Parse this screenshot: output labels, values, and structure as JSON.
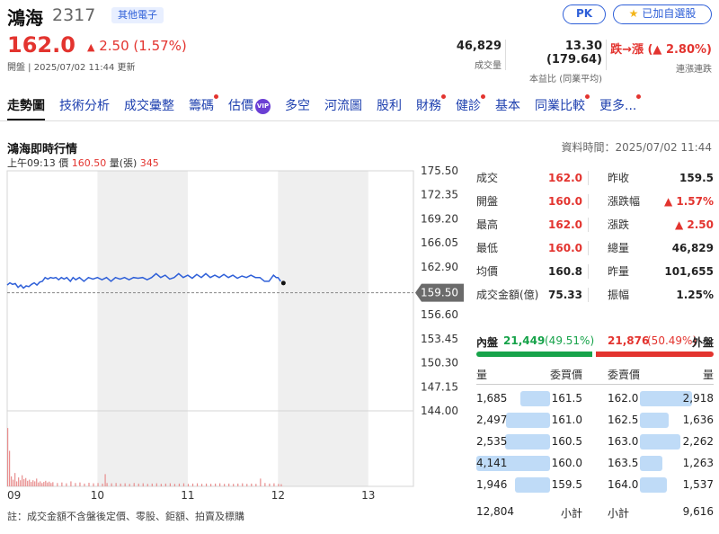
{
  "header": {
    "name": "鴻海",
    "code": "2317",
    "industry": "其他電子",
    "pk_label": "PK",
    "watchlist_label": "已加自選股",
    "price": "162.0",
    "change": "2.50 (1.57%)",
    "status": "開盤 | 2025/07/02 11:44 更新",
    "stats": [
      {
        "value": "46,829",
        "label": "成交量"
      },
      {
        "value": "13.30 (179.64)",
        "label": "本益比 (同業平均)"
      },
      {
        "value": "跌→漲 (▲ 2.80%)",
        "label": "連漲連跌"
      }
    ]
  },
  "tabs": [
    {
      "label": "走勢圖",
      "dot": false,
      "vip": false
    },
    {
      "label": "技術分析",
      "dot": false,
      "vip": false
    },
    {
      "label": "成交彙整",
      "dot": false,
      "vip": false
    },
    {
      "label": "籌碼",
      "dot": true,
      "vip": false
    },
    {
      "label": "估價",
      "dot": false,
      "vip": true
    },
    {
      "label": "多空",
      "dot": false,
      "vip": false
    },
    {
      "label": "河流圖",
      "dot": false,
      "vip": false
    },
    {
      "label": "股利",
      "dot": false,
      "vip": false
    },
    {
      "label": "財務",
      "dot": true,
      "vip": false
    },
    {
      "label": "健診",
      "dot": true,
      "vip": false
    },
    {
      "label": "基本",
      "dot": false,
      "vip": false
    },
    {
      "label": "同業比較",
      "dot": true,
      "vip": false
    },
    {
      "label": "更多...",
      "dot": true,
      "vip": false
    }
  ],
  "vip_label": "VIP",
  "section": {
    "title": "鴻海即時行情",
    "data_time": "資料時間：2025/07/02 11:44",
    "tick_time": "上午09:13",
    "tick_price_label": "價",
    "tick_price": "160.50",
    "tick_vol_label": "量(張)",
    "tick_vol": "345"
  },
  "chart_data": {
    "type": "line",
    "x_tick_labels": [
      "09",
      "10",
      "11",
      "12",
      "13"
    ],
    "y_tick_labels": [
      "175.50",
      "172.35",
      "169.20",
      "166.05",
      "162.90",
      "159.50",
      "156.60",
      "153.45",
      "150.30",
      "147.15",
      "144.00"
    ],
    "ylim": [
      144.0,
      175.5
    ],
    "reference_price": 159.5,
    "x_unit": "hours since 09:00",
    "price_series": [
      [
        0.0,
        160.5
      ],
      [
        0.03,
        160.8
      ],
      [
        0.06,
        160.6
      ],
      [
        0.09,
        160.7
      ],
      [
        0.12,
        160.2
      ],
      [
        0.15,
        160.5
      ],
      [
        0.18,
        160.1
      ],
      [
        0.21,
        160.4
      ],
      [
        0.24,
        160.3
      ],
      [
        0.27,
        160.6
      ],
      [
        0.3,
        160.8
      ],
      [
        0.33,
        160.5
      ],
      [
        0.36,
        160.9
      ],
      [
        0.39,
        161.0
      ],
      [
        0.42,
        161.5
      ],
      [
        0.45,
        161.3
      ],
      [
        0.48,
        161.5
      ],
      [
        0.51,
        161.4
      ],
      [
        0.54,
        161.5
      ],
      [
        0.57,
        161.2
      ],
      [
        0.6,
        161.5
      ],
      [
        0.63,
        161.3
      ],
      [
        0.66,
        161.5
      ],
      [
        0.7,
        161.0
      ],
      [
        0.73,
        161.5
      ],
      [
        0.76,
        161.2
      ],
      [
        0.8,
        161.5
      ],
      [
        0.85,
        161.0
      ],
      [
        0.9,
        161.5
      ],
      [
        0.95,
        161.3
      ],
      [
        1.0,
        161.5
      ],
      [
        1.05,
        161.2
      ],
      [
        1.1,
        161.5
      ],
      [
        1.15,
        161.0
      ],
      [
        1.2,
        161.5
      ],
      [
        1.25,
        161.3
      ],
      [
        1.3,
        161.5
      ],
      [
        1.35,
        161.2
      ],
      [
        1.4,
        161.5
      ],
      [
        1.45,
        161.4
      ],
      [
        1.5,
        161.5
      ],
      [
        1.55,
        161.2
      ],
      [
        1.6,
        161.5
      ],
      [
        1.65,
        162.0
      ],
      [
        1.7,
        161.5
      ],
      [
        1.75,
        161.8
      ],
      [
        1.8,
        161.3
      ],
      [
        1.85,
        161.5
      ],
      [
        1.9,
        162.0
      ],
      [
        1.95,
        161.5
      ],
      [
        2.0,
        161.8
      ],
      [
        2.05,
        161.4
      ],
      [
        2.1,
        161.9
      ],
      [
        2.15,
        161.5
      ],
      [
        2.2,
        162.0
      ],
      [
        2.25,
        161.5
      ],
      [
        2.3,
        161.8
      ],
      [
        2.35,
        161.5
      ],
      [
        2.4,
        161.9
      ],
      [
        2.45,
        161.5
      ],
      [
        2.5,
        161.8
      ],
      [
        2.55,
        161.4
      ],
      [
        2.6,
        161.7
      ],
      [
        2.65,
        161.5
      ],
      [
        2.7,
        161.8
      ],
      [
        2.75,
        161.5
      ],
      [
        2.8,
        161.5
      ],
      [
        2.85,
        161.0
      ],
      [
        2.9,
        161.0
      ],
      [
        2.95,
        161.8
      ],
      [
        2.98,
        161.5
      ],
      [
        3.0,
        161.5
      ],
      [
        3.03,
        161.0
      ]
    ],
    "volume_series": [
      [
        0.0,
        1050
      ],
      [
        0.02,
        640
      ],
      [
        0.04,
        180
      ],
      [
        0.06,
        120
      ],
      [
        0.08,
        240
      ],
      [
        0.1,
        90
      ],
      [
        0.12,
        160
      ],
      [
        0.14,
        110
      ],
      [
        0.16,
        200
      ],
      [
        0.18,
        130
      ],
      [
        0.2,
        150
      ],
      [
        0.22,
        100
      ],
      [
        0.24,
        120
      ],
      [
        0.26,
        80
      ],
      [
        0.28,
        110
      ],
      [
        0.3,
        90
      ],
      [
        0.32,
        140
      ],
      [
        0.34,
        70
      ],
      [
        0.36,
        90
      ],
      [
        0.38,
        60
      ],
      [
        0.4,
        80
      ],
      [
        0.42,
        100
      ],
      [
        0.44,
        70
      ],
      [
        0.46,
        85
      ],
      [
        0.48,
        60
      ],
      [
        0.5,
        75
      ],
      [
        0.55,
        60
      ],
      [
        0.6,
        70
      ],
      [
        0.65,
        55
      ],
      [
        0.7,
        90
      ],
      [
        0.75,
        60
      ],
      [
        0.8,
        70
      ],
      [
        0.85,
        50
      ],
      [
        0.9,
        65
      ],
      [
        0.95,
        55
      ],
      [
        1.0,
        60
      ],
      [
        1.05,
        50
      ],
      [
        1.08,
        220
      ],
      [
        1.1,
        60
      ],
      [
        1.15,
        55
      ],
      [
        1.2,
        60
      ],
      [
        1.25,
        50
      ],
      [
        1.3,
        55
      ],
      [
        1.35,
        45
      ],
      [
        1.4,
        60
      ],
      [
        1.45,
        50
      ],
      [
        1.5,
        55
      ],
      [
        1.55,
        45
      ],
      [
        1.6,
        50
      ],
      [
        1.65,
        55
      ],
      [
        1.7,
        45
      ],
      [
        1.75,
        50
      ],
      [
        1.8,
        55
      ],
      [
        1.85,
        45
      ],
      [
        1.9,
        50
      ],
      [
        1.95,
        55
      ],
      [
        2.0,
        45
      ],
      [
        2.05,
        50
      ],
      [
        2.1,
        55
      ],
      [
        2.15,
        45
      ],
      [
        2.2,
        50
      ],
      [
        2.25,
        45
      ],
      [
        2.3,
        50
      ],
      [
        2.35,
        55
      ],
      [
        2.4,
        45
      ],
      [
        2.45,
        50
      ],
      [
        2.5,
        45
      ],
      [
        2.55,
        50
      ],
      [
        2.6,
        55
      ],
      [
        2.65,
        45
      ],
      [
        2.7,
        50
      ],
      [
        2.75,
        45
      ],
      [
        2.8,
        140
      ],
      [
        2.85,
        60
      ],
      [
        2.9,
        50
      ],
      [
        2.95,
        55
      ],
      [
        3.0,
        45
      ],
      [
        3.03,
        40
      ]
    ]
  },
  "quote": {
    "rows": [
      {
        "k1": "成交",
        "v1": "162.0",
        "c1": "red",
        "k2": "昨收",
        "v2": "159.5",
        "c2": "black"
      },
      {
        "k1": "開盤",
        "v1": "160.0",
        "c1": "red",
        "k2": "漲跌幅",
        "v2": "▲ 1.57%",
        "c2": "red"
      },
      {
        "k1": "最高",
        "v1": "162.0",
        "c1": "red",
        "k2": "漲跌",
        "v2": "▲ 2.50",
        "c2": "red"
      },
      {
        "k1": "最低",
        "v1": "160.0",
        "c1": "red",
        "k2": "總量",
        "v2": "46,829",
        "c2": "black"
      },
      {
        "k1": "均價",
        "v1": "160.8",
        "c1": "black",
        "k2": "昨量",
        "v2": "101,655",
        "c2": "black"
      },
      {
        "k1": "成交金額(億)",
        "v1": "75.33",
        "c1": "black",
        "k2": "振幅",
        "v2": "1.25%",
        "c2": "black"
      }
    ]
  },
  "inout": {
    "in_label": "內盤",
    "in_value": "21,449",
    "in_pct": "(49.51%)",
    "out_value": "21,876",
    "out_pct": "(50.49%)",
    "out_label": "外盤",
    "in_fraction": 0.4951
  },
  "orderbook": {
    "headers": {
      "bid_vol": "量",
      "bid_price": "委買價",
      "ask_price": "委賣價",
      "ask_vol": "量"
    },
    "bids": [
      {
        "vol": "1,685",
        "price": "161.5",
        "level": 1685
      },
      {
        "vol": "2,497",
        "price": "161.0",
        "level": 2497
      },
      {
        "vol": "2,535",
        "price": "160.5",
        "level": 2535
      },
      {
        "vol": "4,141",
        "price": "160.0",
        "level": 4141
      },
      {
        "vol": "1,946",
        "price": "159.5",
        "level": 1946
      }
    ],
    "asks": [
      {
        "price": "162.0",
        "vol": "2,918",
        "level": 2918
      },
      {
        "price": "162.5",
        "vol": "1,636",
        "level": 1636
      },
      {
        "price": "163.0",
        "vol": "2,262",
        "level": 2262
      },
      {
        "price": "163.5",
        "vol": "1,263",
        "level": 1263
      },
      {
        "price": "164.0",
        "vol": "1,537",
        "level": 1537
      }
    ],
    "bid_total": "12,804",
    "subtotal_label": "小計",
    "ask_total": "9,616",
    "max_level": 4141
  },
  "footnote": "註：成交金額不含盤後定價、零股、鉅額、拍賣及標購",
  "colors": {
    "red": "#e3342f",
    "green": "#17a34a",
    "line": "#2e5fd8",
    "bar": "#bfdbf7"
  }
}
